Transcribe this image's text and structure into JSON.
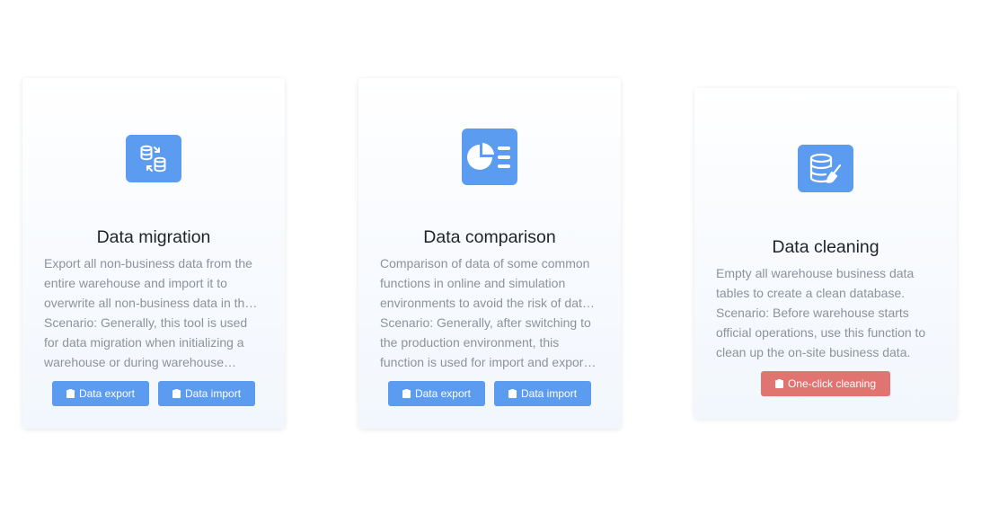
{
  "cards": [
    {
      "title": "Data migration",
      "icon": "database-transfer-icon",
      "description": "Export all non-business data from the entire warehouse and import it to overwrite all non-business data in the warehouse.",
      "scenario": "Scenario: Generally, this tool is used for data migration when initializing a warehouse or during warehouse upgrades.",
      "buttons": [
        "Data export",
        "Data import"
      ]
    },
    {
      "title": "Data comparison",
      "icon": "pie-chart-list-icon",
      "description": "Comparison of data of some common functions in online and simulation environments to avoid the risk of data inconsistency.",
      "scenario": "Scenario: Generally, after switching to the production environment, this function is used for import and export comparison.",
      "buttons": [
        "Data export",
        "Data import"
      ]
    },
    {
      "title": "Data cleaning",
      "icon": "database-broom-icon",
      "description": "Empty all warehouse business data tables to create a clean database.",
      "scenario": "Scenario: Before warehouse starts official operations, use this function to clean up the on-site business data.",
      "buttons": [
        "One-click cleaning"
      ]
    }
  ],
  "colors": {
    "primary": "#5b9cf0",
    "danger": "#e07470",
    "title": "#1f2329",
    "text_muted": "#8c939d"
  }
}
